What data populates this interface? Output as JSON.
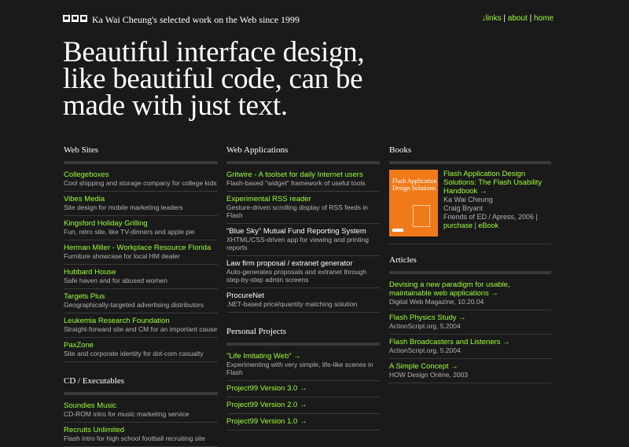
{
  "header": {
    "logo_text": "P99",
    "tagline": "Ka Wai Cheung's selected work on the Web since 1999",
    "links": [
      {
        "label": "↓links"
      },
      {
        "label": "about"
      },
      {
        "label": "home"
      }
    ],
    "separator": "|"
  },
  "hero": {
    "line1": "Beautiful interface design,",
    "line2": "like beautiful code, can be",
    "line3": "made with just text."
  },
  "web_sites": {
    "title": "Web Sites",
    "items": [
      {
        "title": "Collegeboxes",
        "desc": "Cool shipping and storage company for college kids"
      },
      {
        "title": "Vibes Media",
        "desc": "Site design for mobile marketing leaders"
      },
      {
        "title": "Kingsford Holiday Grilling",
        "desc": "Fun, retro site, like TV-dinners and apple pie"
      },
      {
        "title": "Herman Miller - Workplace Resource Florida",
        "desc": "Furniture showcase for local HM dealer"
      },
      {
        "title": "Hubbard House",
        "desc": "Safe haven and for abused women"
      },
      {
        "title": "Targets Plus",
        "desc": "Geographically-targeted advertising distributors"
      },
      {
        "title": "Leukemia Research Foundation",
        "desc": "Straight-forward site and CM for an important cause"
      },
      {
        "title": "PaxZone",
        "desc": "Site and corporate identity for dot-com casualty"
      }
    ]
  },
  "cd_exec": {
    "title": "CD / Executables",
    "items": [
      {
        "title": "Soundies Music",
        "desc": "CD-ROM intro for music marketing service"
      },
      {
        "title": "Recruits Unlimited",
        "desc": "Flash intro for high school football recruiting site"
      }
    ]
  },
  "web_apps": {
    "title": "Web Applications",
    "items": [
      {
        "title": "Gritwire - A toolset for daily Internet users",
        "desc": "Flash-based \"widget\" framework of useful tools",
        "link": true
      },
      {
        "title": "Experimental RSS reader",
        "desc": "Gesture-driven scrolling display of RSS feeds in Flash",
        "link": true
      },
      {
        "title": "\"Blue Sky\" Mutual Fund Reporting System",
        "desc": "XHTML/CSS-driven app for viewing and printing reports",
        "link": false
      },
      {
        "title": "Law firm proposal / extranet generator",
        "desc": "Auto-generates proposals and extranet through step-by-step admin screens",
        "link": false
      },
      {
        "title": "ProcureNet",
        "desc": ".NET-based price/quantity matching solution",
        "link": false
      }
    ]
  },
  "personal": {
    "title": "Personal Projects",
    "items": [
      {
        "title": "\"Life Imitating Web\" →",
        "desc": "Experimenting with very simple, life-like scenes in Flash"
      },
      {
        "title": "Project99 Version 3.0 →",
        "desc": ""
      },
      {
        "title": "Project99 Version 2.0 →",
        "desc": ""
      },
      {
        "title": "Project99 Version 1.0 →",
        "desc": ""
      }
    ]
  },
  "books": {
    "title": "Books",
    "book": {
      "title": "Flash Application Design Solutions: The Flash Usability Handbook →",
      "author1": "Ka Wai Cheung",
      "author2": "Craig Bryant",
      "publisher": "Friends of ED / Apress, 2006 |",
      "purchase": "purchase",
      "sep": "|",
      "ebook": "eBook",
      "cover_title": "Flash Application Design Solutions"
    }
  },
  "articles": {
    "title": "Articles",
    "items": [
      {
        "title": "Devising a new paradigm for usable, maintainable web applications →",
        "desc": "Digital Web Magazine, 10.20.04"
      },
      {
        "title": "Flash Physics Study →",
        "desc": "ActionScript.org, 5.2004"
      },
      {
        "title": "Flash Broadcasters and Listeners →",
        "desc": "ActionScript.org, 5.2004"
      },
      {
        "title": "A Simple Concept →",
        "desc": "HOW Design Online, 2003"
      }
    ]
  },
  "colors": {
    "background": "#1a1a1a",
    "link": "#9dff3c",
    "text": "#ffffff",
    "muted": "#b3b3b3",
    "rule": "#3a3a3a"
  }
}
